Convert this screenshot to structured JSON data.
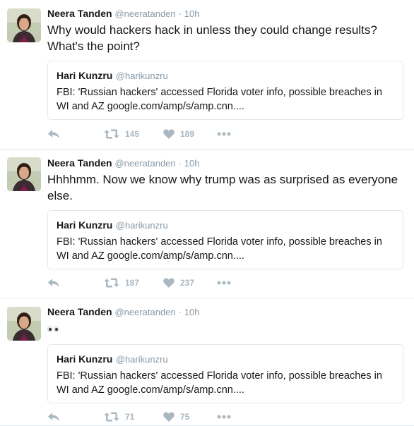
{
  "tweets": [
    {
      "author_name": "Neera Tanden",
      "author_handle": "@neeratanden",
      "separator": "·",
      "time": "10h",
      "text": "Why would hackers hack in unless they could change results? What's the point?",
      "quote": {
        "name": "Hari Kunzru",
        "handle": "@harikunzru",
        "text": "FBI: 'Russian hackers' accessed Florida voter info, possible breaches in WI and AZ  google.com/amp/s/amp.cnn...."
      },
      "retweets": "145",
      "likes": "189"
    },
    {
      "author_name": "Neera Tanden",
      "author_handle": "@neeratanden",
      "separator": "·",
      "time": "10h",
      "text": "Hhhhmm. Now we know why trump was as surprised as everyone else.",
      "quote": {
        "name": "Hari Kunzru",
        "handle": "@harikunzru",
        "text": "FBI: 'Russian hackers' accessed Florida voter info, possible breaches in WI and AZ  google.com/amp/s/amp.cnn...."
      },
      "retweets": "187",
      "likes": "237"
    },
    {
      "author_name": "Neera Tanden",
      "author_handle": "@neeratanden",
      "separator": "·",
      "time": "10h",
      "text_emoji": "eyes-emoji",
      "quote": {
        "name": "Hari Kunzru",
        "handle": "@harikunzru",
        "text": "FBI: 'Russian hackers' accessed Florida voter info, possible breaches in WI and AZ  google.com/amp/s/amp.cnn...."
      },
      "retweets": "71",
      "likes": "75"
    }
  ],
  "icons": {
    "reply": "reply-icon",
    "retweet": "retweet-icon",
    "like": "heart-icon",
    "more": "more-icon"
  },
  "colors": {
    "text": "#14171a",
    "muted": "#8899a6",
    "action_gray": "#aab8c2",
    "border": "#e1e8ed"
  }
}
